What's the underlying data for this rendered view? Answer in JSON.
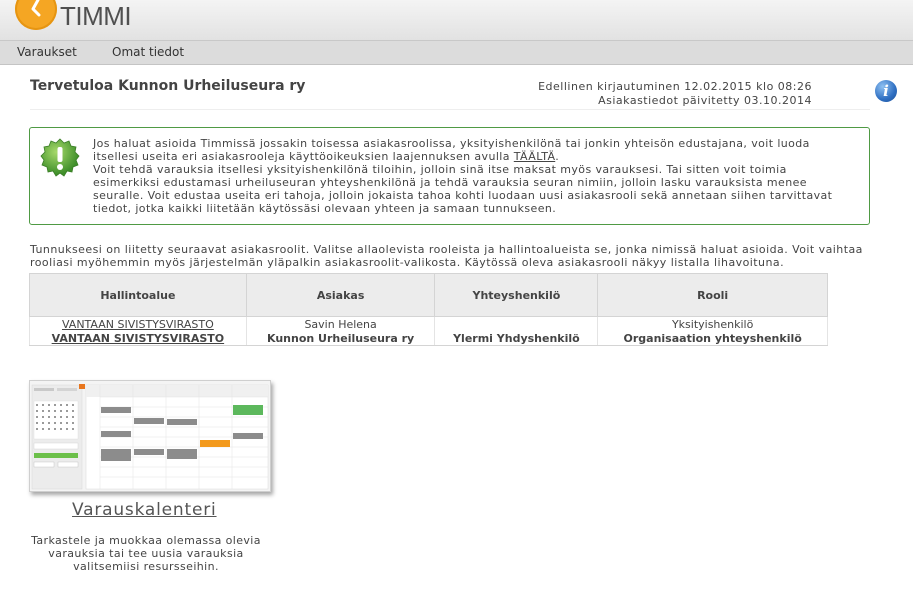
{
  "header": {
    "logo_text": "TIMMI"
  },
  "nav": {
    "items": [
      "Varaukset",
      "Omat tiedot"
    ]
  },
  "welcome": {
    "title": "Tervetuloa  Kunnon Urheiluseura ry"
  },
  "login_info": {
    "last_login": "Edellinen kirjautuminen  12.02.2015  klo  08:26",
    "updated": "Asiakastiedot päivitetty  03.10.2014"
  },
  "info_icon": {
    "label": "i"
  },
  "notice": {
    "text_before_link": "Jos haluat asioida Timmissä jossakin toisessa asiakasroolissa, yksityishenkilönä tai jonkin yhteisön edustajana, voit luoda itsellesi useita eri asiakasrooleja käyttöoikeuksien laajennuksen avulla ",
    "link": "TÄÄLTÄ",
    "text_after_link": ".",
    "paragraph2": "Voit tehdä varauksia itsellesi yksityishenkilönä tiloihin, jolloin sinä itse maksat myös varauksesi. Tai sitten voit toimia esimerkiksi edustamasi urheiluseuran yhteyshenkilönä ja tehdä varauksia seuran nimiin, jolloin lasku varauksista menee seuralle. Voit edustaa useita eri tahoja, jolloin jokaista tahoa kohti luodaan uusi asiakasrooli sekä annetaan siihen tarvittavat tiedot, jotka kaikki liitetään käytössäsi olevaan yhteen ja samaan tunnukseen."
  },
  "intro": {
    "text": "Tunnukseesi on liitetty seuraavat asiakasroolit. Valitse allaolevista rooleista ja hallintoalueista se, jonka nimissä haluat asioida. Voit vaihtaa rooliasi myöhemmin myös järjestelmän yläpalkin asiakasroolit-valikosta. Käytössä oleva asiakasrooli näkyy listalla lihavoituna."
  },
  "roles_table": {
    "headers": [
      "Hallintoalue",
      "Asiakas",
      "Yhteyshenkilö",
      "Rooli"
    ],
    "rows": [
      [
        "VANTAAN SIVISTYSVIRASTO",
        "Savin Helena",
        "",
        "Yksityishenkilö"
      ],
      [
        "VANTAAN SIVISTYSVIRASTO",
        "Kunnon Urheiluseura ry",
        "Ylermi Yhdyshenkilö",
        "Organisaation yhteyshenkilö"
      ]
    ]
  },
  "calendar_card": {
    "title": "Varauskalenteri",
    "description": "Tarkastele ja muokkaa olemassa olevia varauksia tai tee uusia varauksia valitsemiisi resursseihin."
  },
  "colors": {
    "logo": "#f5a623",
    "notice_border": "#4f9a44",
    "info_icon": "#2f6fc2",
    "nav_bar": "#dcdcdc"
  }
}
